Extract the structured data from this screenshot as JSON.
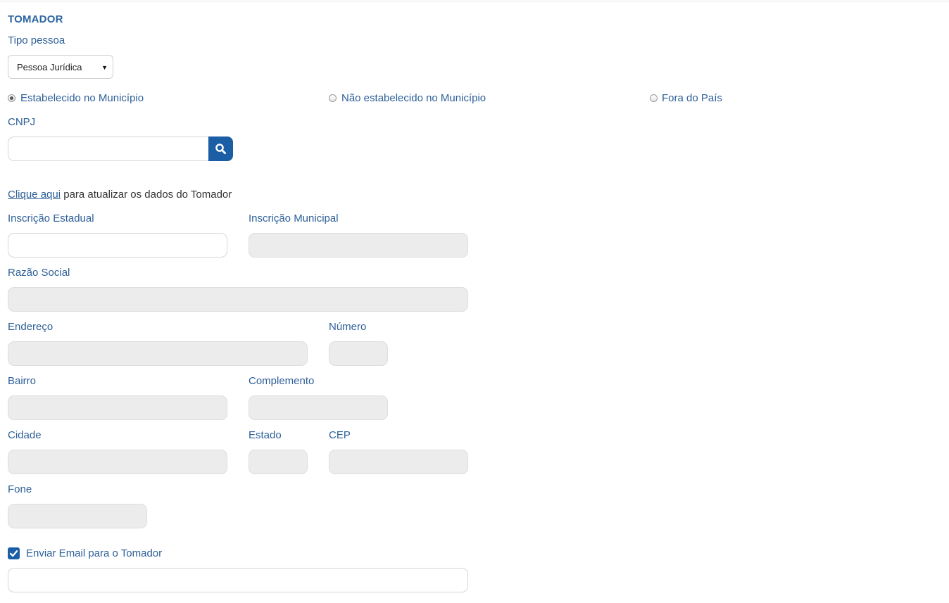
{
  "section": {
    "title": "TOMADOR"
  },
  "tipo_pessoa": {
    "label": "Tipo pessoa",
    "selected": "Pessoa Jurídica"
  },
  "localizacao": {
    "options": [
      {
        "label": "Estabelecido no Município",
        "checked": true
      },
      {
        "label": "Não estabelecido no Município",
        "checked": false
      },
      {
        "label": "Fora do País",
        "checked": false
      }
    ]
  },
  "cnpj": {
    "label": "CNPJ",
    "value": ""
  },
  "update_link": {
    "link_text": "Clique aqui",
    "rest_text": " para atualizar os dados do Tomador"
  },
  "fields": {
    "inscricao_estadual": {
      "label": "Inscrição Estadual",
      "value": ""
    },
    "inscricao_municipal": {
      "label": "Inscrição Municipal",
      "value": ""
    },
    "razao_social": {
      "label": "Razão Social",
      "value": ""
    },
    "endereco": {
      "label": "Endereço",
      "value": ""
    },
    "numero": {
      "label": "Número",
      "value": ""
    },
    "bairro": {
      "label": "Bairro",
      "value": ""
    },
    "complemento": {
      "label": "Complemento",
      "value": ""
    },
    "cidade": {
      "label": "Cidade",
      "value": ""
    },
    "estado": {
      "label": "Estado",
      "value": ""
    },
    "cep": {
      "label": "CEP",
      "value": ""
    },
    "fone": {
      "label": "Fone",
      "value": ""
    }
  },
  "email": {
    "checkbox_label": "Enviar Email para o Tomador",
    "checked": true,
    "value": ""
  },
  "colors": {
    "accent": "#1b5ea6",
    "label": "#2d5f98",
    "disabled_field": "#ececec"
  },
  "icons": {
    "search": "search-icon",
    "checkmark": "checkmark-icon",
    "dropdown": "chevron-down-icon"
  }
}
